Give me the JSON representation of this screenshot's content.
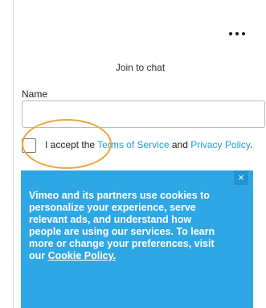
{
  "header": {
    "more_icon": "more-horizontal-icon",
    "title": "Join to chat"
  },
  "form": {
    "name_label": "Name",
    "name_value": "",
    "name_placeholder": ""
  },
  "consent": {
    "checked": false,
    "prefix": "I accept the ",
    "terms_link": "Terms of Service",
    "middle": " and ",
    "privacy_link": "Privacy Policy",
    "suffix": "."
  },
  "cookie_banner": {
    "close_label": "×",
    "message": "Vimeo and its partners use cookies to personalize your experience, serve relevant ads, and understand how people are using our services. To learn more or change your preferences, visit our ",
    "link_label": "Cookie Policy.",
    "background_color": "#2fa7e4"
  },
  "annotation": {
    "highlight_color": "#f0a43a"
  },
  "colors": {
    "link": "#1a9fd8"
  }
}
